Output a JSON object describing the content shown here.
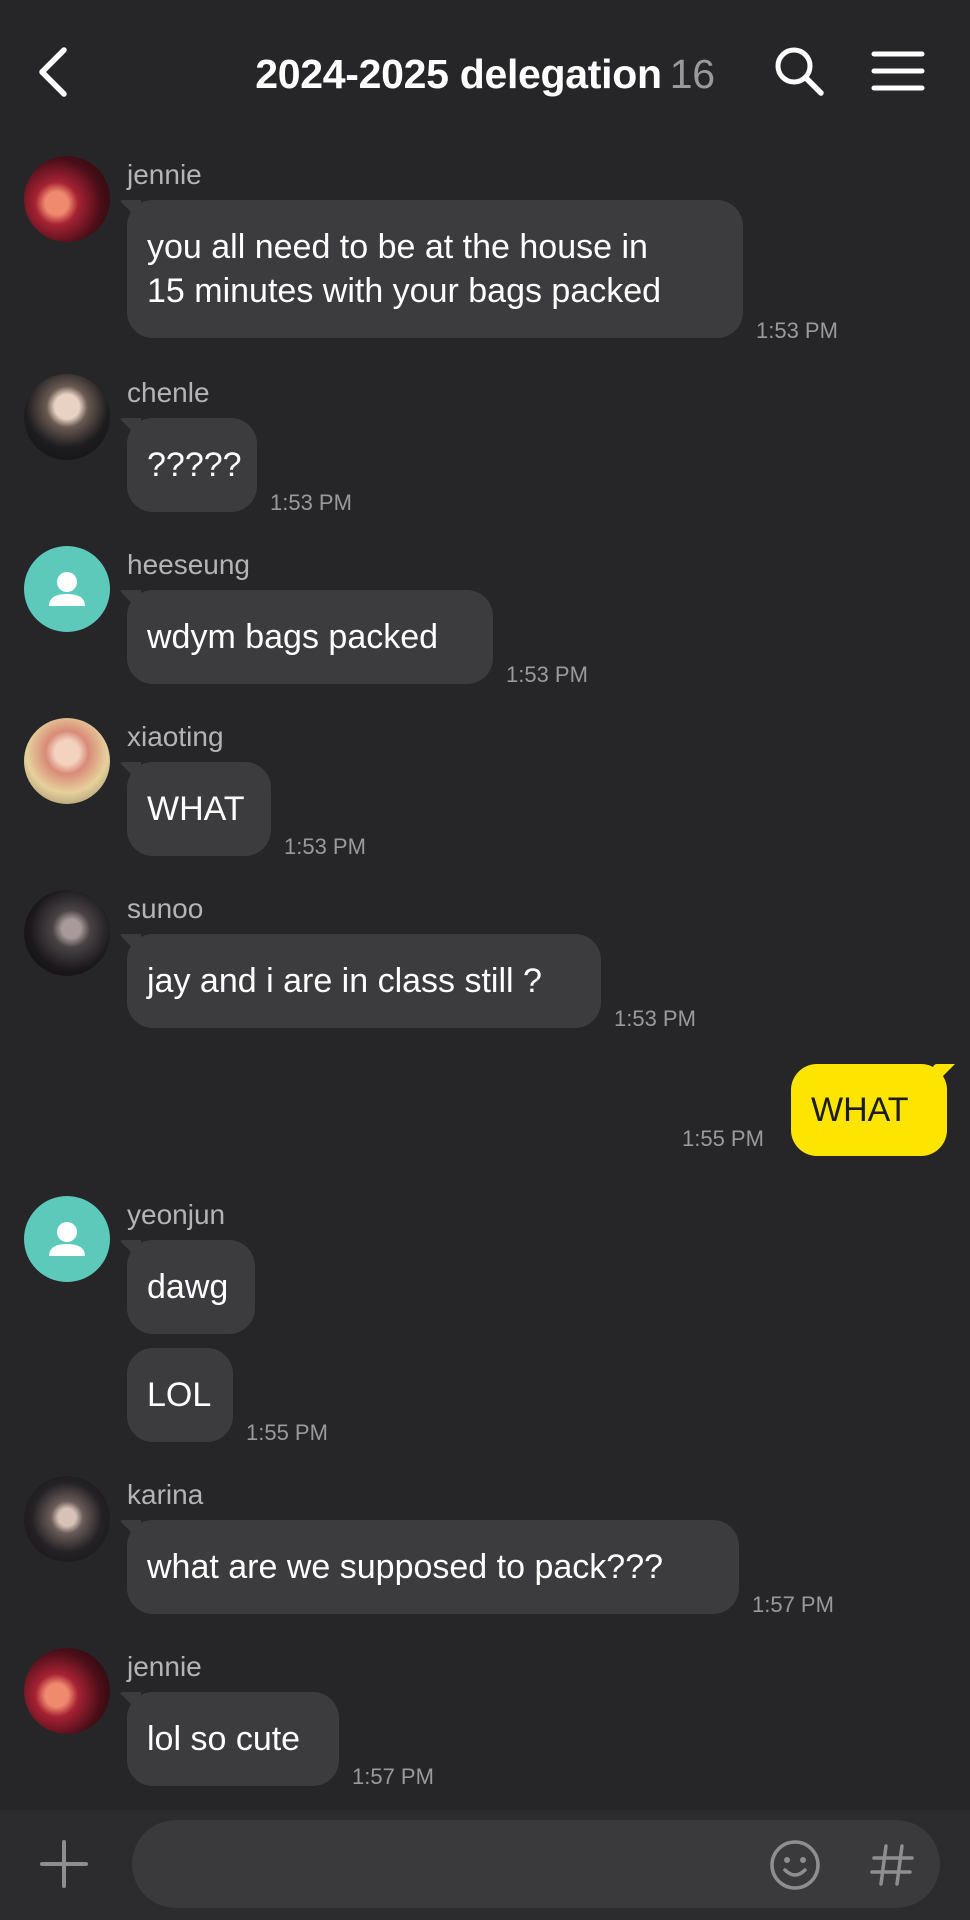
{
  "header": {
    "title": "2024-2025 delegation",
    "member_count": "16",
    "icons": [
      "chevron-left-icon",
      "search-icon",
      "hamburger-menu-icon"
    ]
  },
  "messages": [
    {
      "sender": "jennie",
      "lines": [
        "you all need to be at the house in",
        "15 minutes with your bags packed"
      ],
      "time": "1:53 PM",
      "avatar": "photo"
    },
    {
      "sender": "chenle",
      "lines": [
        "?????"
      ],
      "time": "1:53 PM",
      "avatar": "photo"
    },
    {
      "sender": "heeseung",
      "lines": [
        "wdym bags packed"
      ],
      "time": "1:53 PM",
      "avatar": "default-person-icon"
    },
    {
      "sender": "xiaoting",
      "lines": [
        "WHAT"
      ],
      "time": "1:53 PM",
      "avatar": "photo"
    },
    {
      "sender": "sunoo",
      "lines": [
        "jay and i are in class still ?"
      ],
      "time": "1:53 PM",
      "avatar": "photo"
    },
    {
      "sender": "",
      "lines": [
        "WHAT"
      ],
      "time": "1:55 PM",
      "outgoing": true
    },
    {
      "sender": "yeonjun",
      "lines": [
        "dawg"
      ],
      "time": "",
      "avatar": "default-person-icon"
    },
    {
      "sender": "",
      "lines": [
        "LOL"
      ],
      "time": "1:55 PM",
      "continuation": true
    },
    {
      "sender": "karina",
      "lines": [
        "what are we supposed to pack???"
      ],
      "time": "1:57 PM",
      "avatar": "photo"
    },
    {
      "sender": "jennie",
      "lines": [
        "lol so cute"
      ],
      "time": "1:57 PM",
      "avatar": "photo"
    }
  ],
  "input_bar": {
    "value": "",
    "placeholder": "",
    "icons": [
      "plus-icon",
      "emoji-icon",
      "hash-icon"
    ]
  },
  "colors": {
    "background": "#262628",
    "incoming_bubble": "#3c3c3e",
    "outgoing_bubble": "#fee500",
    "default_avatar": "#5cc9ba",
    "secondary_text": "#9a9a9c"
  }
}
